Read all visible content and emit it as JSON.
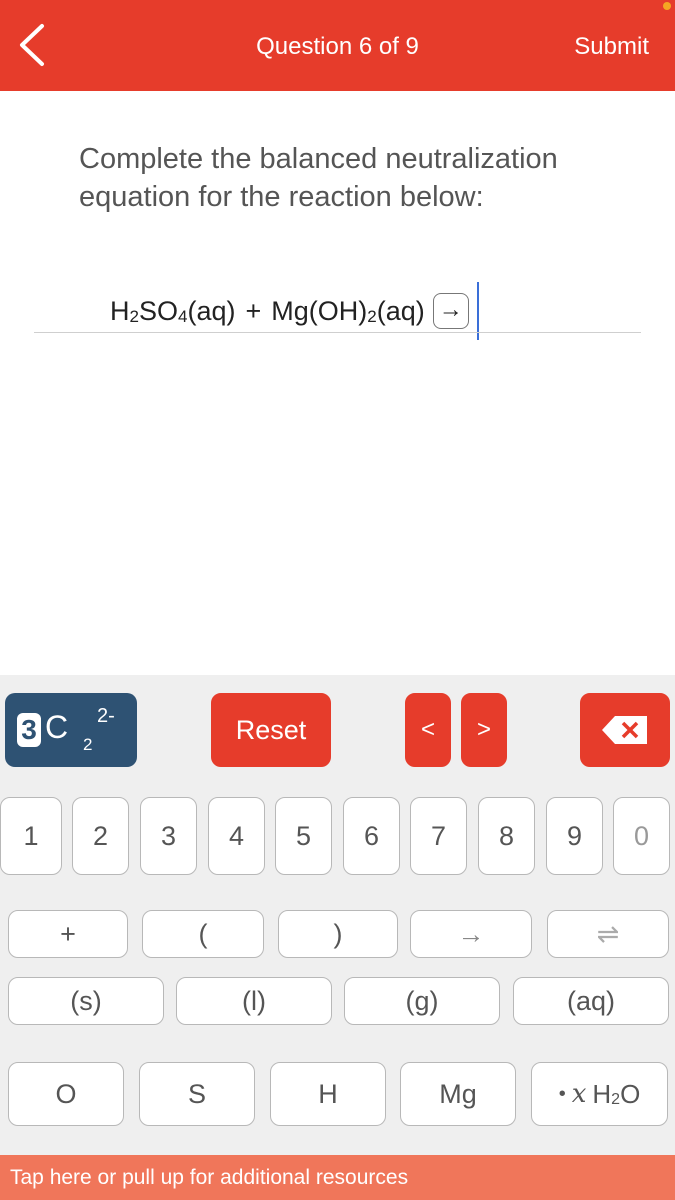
{
  "header": {
    "title": "Question 6 of 9",
    "submit_label": "Submit"
  },
  "question": {
    "prompt": "Complete the balanced neutralization equation for the reaction below:",
    "equation": {
      "r1_a": "H",
      "r1_a_sub": "2",
      "r1_b": "SO",
      "r1_b_sub": "4",
      "r1_state": "(aq)",
      "plus": "+",
      "r2_a": "Mg(OH)",
      "r2_a_sub": "2",
      "r2_state": "(aq)",
      "arrow": "→"
    }
  },
  "keyboard": {
    "template_key": {
      "badge": "3",
      "symbol": "C",
      "sub": "2",
      "sup": "2-"
    },
    "reset_label": "Reset",
    "nav_left": "<",
    "nav_right": ">",
    "backspace_icon": "✕",
    "digits": [
      "1",
      "2",
      "3",
      "4",
      "5",
      "6",
      "7",
      "8",
      "9",
      "0"
    ],
    "symbols": [
      "+",
      "(",
      ")",
      "→",
      "⇌"
    ],
    "states": [
      "(s)",
      "(l)",
      "(g)",
      "(aq)"
    ],
    "elements": [
      "O",
      "S",
      "H",
      "Mg"
    ],
    "water_key": {
      "dot": "•",
      "x": "x",
      "h": "H",
      "h_sub": "2",
      "o": "O"
    }
  },
  "footer": {
    "text": "Tap here or pull up for additional resources"
  },
  "colors": {
    "header": "#e63c2b",
    "template_key": "#2e5273",
    "footer": "#f0765a",
    "cursor": "#3a6fd8"
  }
}
